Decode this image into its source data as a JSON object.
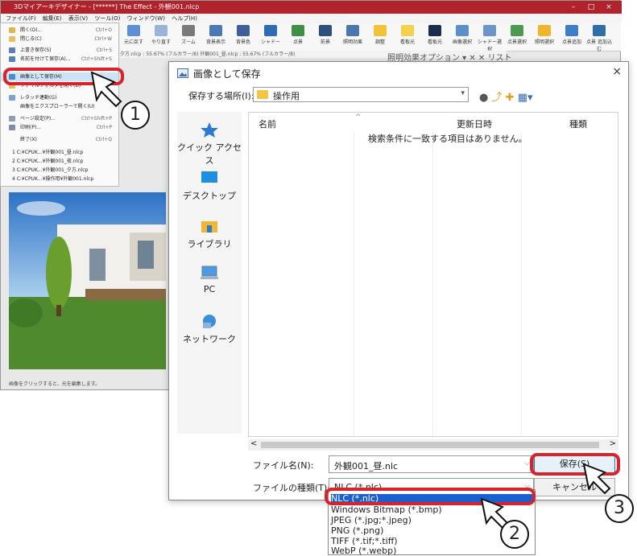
{
  "app": {
    "title": "3Dマイアーキデザイナー - [******] The Effect - 外観001.nlcp",
    "window_buttons": [
      "–",
      "□",
      "×"
    ],
    "menus": [
      "ファイル(F)",
      "編集(E)",
      "表示(V)",
      "ツール(O)",
      "ウィンドウ(W)",
      "ヘルプ(H)"
    ],
    "ribbon_buttons": [
      "元に戻す",
      "やり直す",
      "ズーム",
      "背景表示",
      "背景色",
      "シャドー",
      "点景",
      "前景",
      "照明効果",
      "調整",
      "看板光",
      "看板光",
      "画像選択",
      "シャドー選択",
      "点景選択",
      "照明選択",
      "点景追加",
      "点景 追加込む"
    ],
    "tab_strip": "夕方.nlcp : 55.67% (フルカラー/8)   外観001_昼.nlcp : 55.67% (フルカラー/8)",
    "option_strip": "照明効果オプション   ▾ ✕ ✕ リスト",
    "status": "画像をクリックすると、光を編集します。"
  },
  "file_menu": {
    "items": [
      {
        "label": "開く(O)...",
        "shortcut": "Ctrl+O"
      },
      {
        "label": "閉じる(C)",
        "shortcut": "Ctrl+W"
      },
      {
        "label": "上書き保存(S)",
        "shortcut": "Ctrl+S"
      },
      {
        "label": "名前を付けて保存(A)...",
        "shortcut": "Ctrl+Shift+S"
      },
      {
        "label": "画像として保存(M)",
        "shortcut": ""
      },
      {
        "label": "ファイルフォルダを開く(D)",
        "shortcut": ""
      },
      {
        "label": "レタッチ連動(G)",
        "shortcut": ""
      },
      {
        "label": "画像をエクスプローラーで開く(U)",
        "shortcut": ""
      },
      {
        "label": "ページ設定(P)...",
        "shortcut": "Ctrl+Shift+P"
      },
      {
        "label": "印刷(P)...",
        "shortcut": "Ctrl+P"
      },
      {
        "label": "終了(X)",
        "shortcut": "Ctrl+Q"
      },
      {
        "label": "1 C:¥CPUK...¥外観001_昼.nlcp",
        "shortcut": ""
      },
      {
        "label": "2 C:¥CPUK...¥外観001_夜.nlcp",
        "shortcut": ""
      },
      {
        "label": "3 C:¥CPUK...¥外観001_夕方.nlcp",
        "shortcut": ""
      },
      {
        "label": "4 C:¥CPUK...¥操作用¥外観001.nlcp",
        "shortcut": ""
      }
    ]
  },
  "dialog": {
    "title": "画像として保存",
    "close": "×",
    "save_in_label": "保存する場所(I):",
    "save_in_value": "操作用",
    "nav_icons": "● ⤴ ✚ ▦▾",
    "places": [
      "クイック アクセス",
      "デスクトップ",
      "ライブラリ",
      "PC",
      "ネットワーク"
    ],
    "columns": [
      "名前",
      "更新日時",
      "種類"
    ],
    "empty_message": "検索条件に一致する項目はありません。",
    "scroll_left": "<",
    "scroll_right": ">",
    "filename_label": "ファイル名(N):",
    "filename_value": "外観001_昼.nlc",
    "filetype_label": "ファイルの種類(T):",
    "filetype_value": "NLC (*.nlc)",
    "save_button": "保存(S)",
    "cancel_button": "キャンセル"
  },
  "filetype_options": [
    "NLC (*.nlc)",
    "Windows Bitmap (*.bmp)",
    "JPEG (*.jpg;*.jpeg)",
    "PNG (*.png)",
    "TIFF (*.tif;*.tiff)",
    "WebP (*.webp)"
  ],
  "callouts": [
    "1",
    "2",
    "3"
  ],
  "colors": {
    "highlight_ring": "#d8232a",
    "titlebar": "#b2222a",
    "selection": "#1a5fcf"
  }
}
